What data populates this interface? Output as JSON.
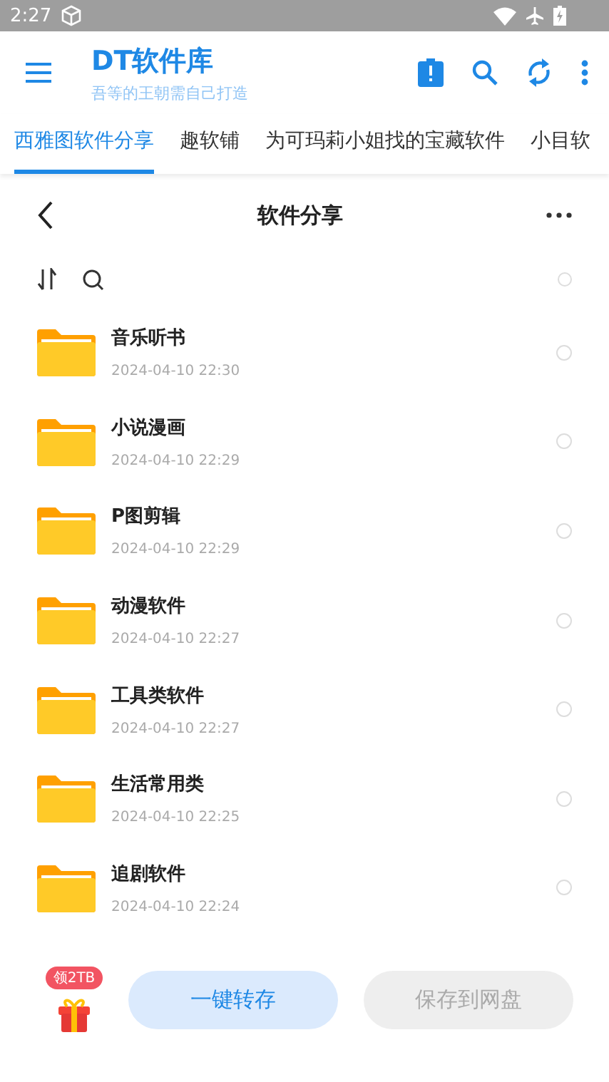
{
  "status_bar": {
    "time": "2:27"
  },
  "app_bar": {
    "title": "DT软件库",
    "subtitle": "吾等的王朝需自己打造"
  },
  "tabs": [
    {
      "label": "西雅图软件分享",
      "selected": true
    },
    {
      "label": "趣软铺",
      "selected": false
    },
    {
      "label": "为可玛莉小姐找的宝藏软件",
      "selected": false
    },
    {
      "label": "小目软",
      "selected": false
    }
  ],
  "page_header": {
    "title": "软件分享"
  },
  "select_all": {
    "selected": false
  },
  "files": [
    {
      "name": "音乐听书",
      "date": "2024-04-10 22:30",
      "selected": false
    },
    {
      "name": "小说漫画",
      "date": "2024-04-10 22:29",
      "selected": false
    },
    {
      "name": "P图剪辑",
      "date": "2024-04-10 22:29",
      "selected": false
    },
    {
      "name": "动漫软件",
      "date": "2024-04-10 22:27",
      "selected": false
    },
    {
      "name": "工具类软件",
      "date": "2024-04-10 22:27",
      "selected": false
    },
    {
      "name": "生活常用类",
      "date": "2024-04-10 22:25",
      "selected": false
    },
    {
      "name": "追剧软件",
      "date": "2024-04-10 22:24",
      "selected": false
    }
  ],
  "bottom_bar": {
    "gift_badge": "领2TB",
    "buttons": [
      {
        "label": "一键转存",
        "disabled": false
      },
      {
        "label": "保存到网盘",
        "disabled": true
      }
    ]
  }
}
